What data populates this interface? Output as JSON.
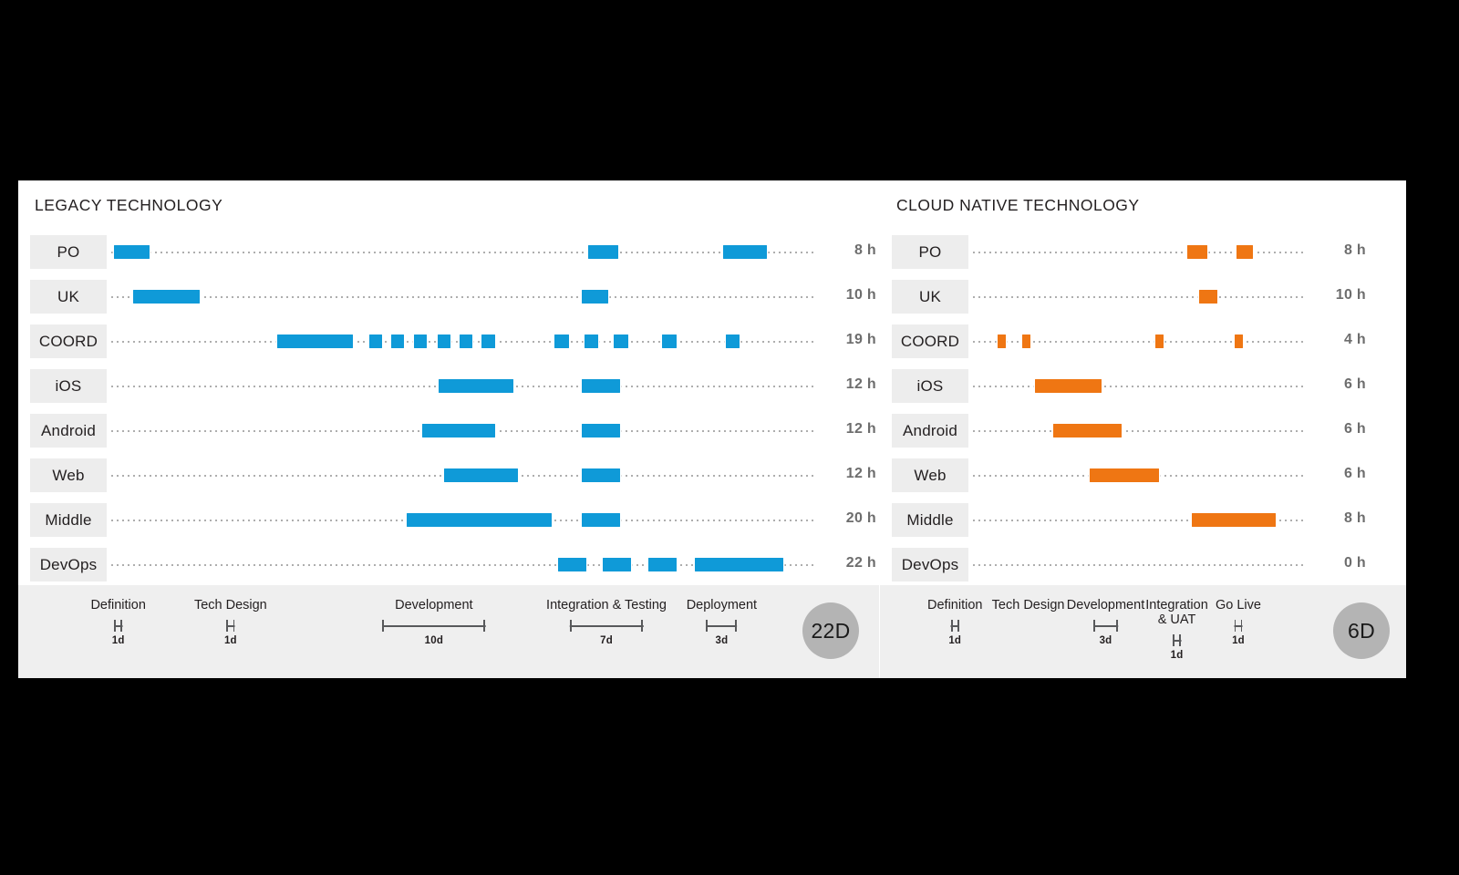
{
  "meta": {
    "background_color": "#000000",
    "card_color": "#ffffff",
    "footer_color": "#efefef",
    "legacy_bar_color": "#0f9ad8",
    "cloud_bar_color": "#ef7613",
    "label_chip_color": "#ededed",
    "badge_color": "#b4b4b4",
    "dot_color": "#9a9a9a"
  },
  "chart_data": {
    "type": "gantt",
    "title": "Legacy Technology vs Cloud Native Technology delivery timeline",
    "panels": [
      {
        "id": "legacy",
        "title": "LEGACY TECHNOLOGY",
        "bar_color": "#0f9ad8",
        "total_days": "22D",
        "row_labels": [
          "PO",
          "UK",
          "COORD",
          "iOS",
          "Android",
          "Web",
          "Middle",
          "DevOps"
        ],
        "hours": [
          "8 h",
          "10 h",
          "19 h",
          "12 h",
          "12 h",
          "12 h",
          "20 h",
          "22 h"
        ],
        "phases": [
          {
            "name": "Definition",
            "days": "1d",
            "center_pct": 9.9,
            "span_pct": 0.0
          },
          {
            "name": "Tech Design",
            "days": "1d",
            "center_pct": 25.2,
            "span_pct": 0.0
          },
          {
            "name": "Development",
            "days": "10d",
            "center_pct": 52.9,
            "span_pct": 14.0
          },
          {
            "name": "Integration & Testing",
            "days": "7d",
            "center_pct": 76.4,
            "span_pct": 10.0
          },
          {
            "name": "Deployment",
            "days": "3d",
            "center_pct": 92.1,
            "span_pct": 4.2
          }
        ],
        "rows": [
          {
            "label": "PO",
            "hours": "8 h",
            "bars": [
              [
                0.7,
                5.7
              ],
              [
                67.8,
                72.0
              ],
              [
                86.9,
                93.0
              ]
            ]
          },
          {
            "label": "UK",
            "hours": "10 h",
            "bars": [
              [
                3.3,
                12.8
              ],
              [
                66.9,
                70.6
              ]
            ]
          },
          {
            "label": "COORD",
            "hours": "19 h",
            "bars": [
              [
                23.7,
                34.4
              ],
              [
                36.8,
                38.6
              ],
              [
                39.9,
                41.7
              ],
              [
                43.1,
                44.9
              ],
              [
                46.4,
                48.2
              ],
              [
                49.6,
                51.4
              ],
              [
                52.7,
                54.6
              ],
              [
                63.0,
                65.0
              ],
              [
                67.2,
                69.2
              ],
              [
                71.4,
                73.4
              ],
              [
                78.2,
                80.2
              ],
              [
                87.2,
                89.2
              ]
            ]
          },
          {
            "label": "iOS",
            "hours": "12 h",
            "bars": [
              [
                46.6,
                57.1
              ],
              [
                66.9,
                72.2
              ]
            ]
          },
          {
            "label": "Android",
            "hours": "12 h",
            "bars": [
              [
                44.2,
                54.6
              ],
              [
                66.9,
                72.2
              ]
            ]
          },
          {
            "label": "Web",
            "hours": "12 h",
            "bars": [
              [
                47.3,
                57.8
              ],
              [
                66.9,
                72.2
              ]
            ]
          },
          {
            "label": "Middle",
            "hours": "20 h",
            "bars": [
              [
                42.0,
                62.6
              ],
              [
                66.9,
                72.2
              ]
            ]
          },
          {
            "label": "DevOps",
            "hours": "22 h",
            "bars": [
              [
                63.5,
                67.5
              ],
              [
                69.8,
                73.8
              ],
              [
                76.2,
                80.3
              ],
              [
                82.8,
                95.3
              ]
            ]
          }
        ]
      },
      {
        "id": "cloud",
        "title": "CLOUD NATIVE TECHNOLOGY",
        "bar_color": "#ef7613",
        "total_days": "6D",
        "row_labels": [
          "PO",
          "UK",
          "COORD",
          "iOS",
          "Android",
          "Web",
          "Middle",
          "DevOps"
        ],
        "hours": [
          "8 h",
          "10 h",
          "4 h",
          "6 h",
          "6 h",
          "6 h",
          "8 h",
          "0 h"
        ],
        "phases": [
          {
            "name": "Definition",
            "days": "1d",
            "center_pct": 14.0,
            "span_pct": 0.0
          },
          {
            "name": "Tech Design",
            "days": "",
            "center_pct": 31.5,
            "span_pct": 0.0
          },
          {
            "name": "Development",
            "days": "3d",
            "center_pct": 50.0,
            "span_pct": 6.0
          },
          {
            "name": "Integration\n& UAT",
            "days": "1d",
            "center_pct": 67.0,
            "span_pct": 0.0
          },
          {
            "name": "Go Live",
            "days": "1d",
            "center_pct": 81.7,
            "span_pct": 0.0
          }
        ],
        "rows": [
          {
            "label": "PO",
            "hours": "8 h",
            "bars": [
              [
                64.6,
                70.6
              ],
              [
                79.4,
                84.2
              ]
            ]
          },
          {
            "label": "UK",
            "hours": "10 h",
            "bars": [
              [
                68.0,
                73.7
              ]
            ]
          },
          {
            "label": "COORD",
            "hours": "4 h",
            "bars": [
              [
                7.9,
                10.4
              ],
              [
                15.2,
                17.7
              ],
              [
                55.0,
                57.5
              ],
              [
                78.8,
                81.3
              ]
            ]
          },
          {
            "label": "iOS",
            "hours": "6 h",
            "bars": [
              [
                19.0,
                39.0
              ]
            ]
          },
          {
            "label": "Android",
            "hours": "6 h",
            "bars": [
              [
                24.5,
                45.0
              ]
            ]
          },
          {
            "label": "Web",
            "hours": "6 h",
            "bars": [
              [
                35.5,
                56.0
              ]
            ]
          },
          {
            "label": "Middle",
            "hours": "8 h",
            "bars": [
              [
                66.0,
                91.0
              ]
            ]
          },
          {
            "label": "DevOps",
            "hours": "0 h",
            "bars": []
          }
        ]
      }
    ]
  }
}
